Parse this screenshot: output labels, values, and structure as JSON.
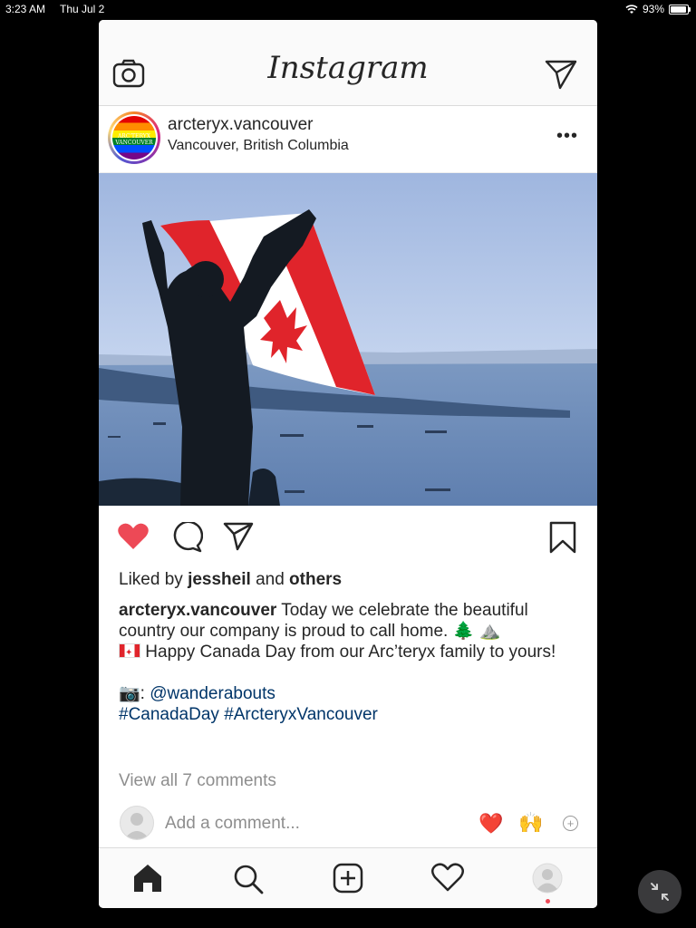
{
  "status_bar": {
    "time": "3:23 AM",
    "date": "Thu Jul 2",
    "battery": "93%",
    "battery_level": 0.93
  },
  "app": {
    "logo": "Instagram"
  },
  "post": {
    "username": "arcteryx.vancouver",
    "location": "Vancouver, British Columbia",
    "avatar_text": "ARC'TERYX VANCOUVER",
    "liked_by_prefix": "Liked by",
    "liked_by_user": "jessheil",
    "liked_by_and": "and",
    "liked_by_others": "others",
    "caption_username": "arcteryx.vancouver",
    "caption_text": "Today we celebrate the beautiful country our company is proud to call home. 🌲 ⛰️",
    "caption_line2": "Happy Canada Day from our Arc’teryx family to yours!",
    "photo_credit_prefix": "📷:",
    "photo_credit_handle": "@wanderabouts",
    "hashtags": "#CanadaDay #ArcteryxVancouver",
    "view_comments": "View all 7 comments"
  },
  "comment_box": {
    "placeholder": "Add a comment...",
    "quick_reactions": [
      "❤️",
      "🙌"
    ],
    "more": "+"
  },
  "colors": {
    "like_red": "#ed4956",
    "link_blue": "#003569",
    "muted": "#8e8e8e"
  },
  "icons": {
    "top": [
      "camera-icon",
      "direct-message-icon"
    ],
    "actions": [
      "heart-icon",
      "comment-icon",
      "share-icon",
      "bookmark-icon"
    ],
    "tabs": [
      "home-icon",
      "search-icon",
      "add-post-icon",
      "activity-heart-icon",
      "profile-icon"
    ],
    "floating": "minimize-arrows-icon"
  }
}
